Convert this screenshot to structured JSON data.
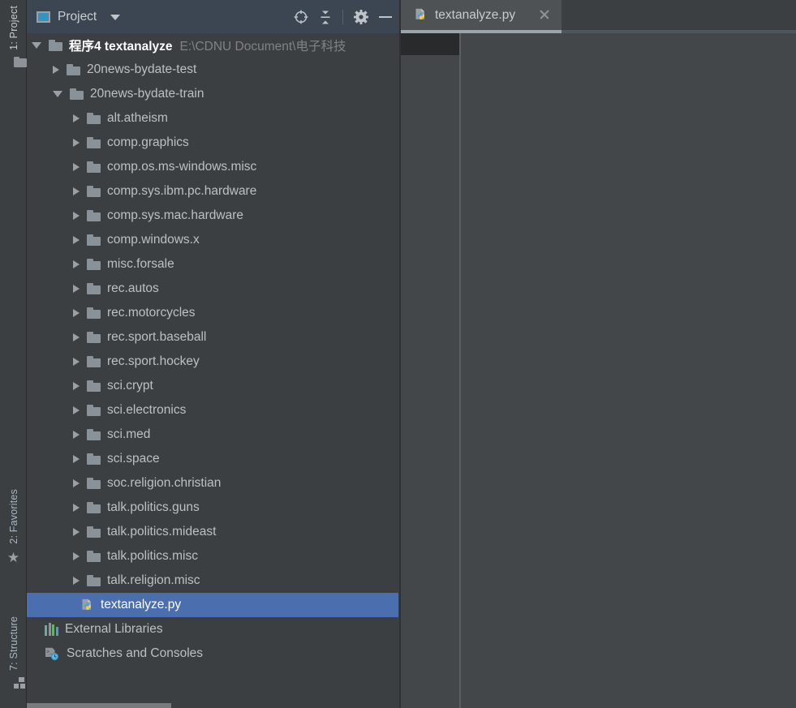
{
  "window": {
    "theme_background": "#3c3f41",
    "accent_selection": "#4b6eaf",
    "header_background": "#3c4652"
  },
  "left_tool_bar": {
    "tabs": [
      {
        "label": "1: Project",
        "icon": "folder-icon",
        "active": true
      },
      {
        "label": "2: Favorites",
        "icon": "star-icon",
        "active": false
      },
      {
        "label": "7: Structure",
        "icon": "structure-icon",
        "active": false
      }
    ]
  },
  "project_panel": {
    "title": "Project",
    "title_icon": "project-window-icon",
    "dropdown_icon": "chevron-down-icon",
    "toolbar_buttons": [
      {
        "name": "locate-in-tree",
        "icon": "crosshair-target-icon"
      },
      {
        "name": "collapse-all",
        "icon": "collapse-all-icon"
      },
      {
        "name": "settings",
        "icon": "gear-icon"
      },
      {
        "name": "hide",
        "icon": "minimize-icon"
      }
    ],
    "tree": [
      {
        "label": "程序4 textanalyze",
        "path": "E:\\CDNU Document\\电子科技",
        "type": "root",
        "state": "expanded",
        "level": 0
      },
      {
        "label": "20news-bydate-test",
        "type": "folder",
        "state": "collapsed",
        "level": 1
      },
      {
        "label": "20news-bydate-train",
        "type": "folder",
        "state": "expanded",
        "level": 1
      },
      {
        "label": "alt.atheism",
        "type": "folder",
        "state": "collapsed",
        "level": 2
      },
      {
        "label": "comp.graphics",
        "type": "folder",
        "state": "collapsed",
        "level": 2
      },
      {
        "label": "comp.os.ms-windows.misc",
        "type": "folder",
        "state": "collapsed",
        "level": 2
      },
      {
        "label": "comp.sys.ibm.pc.hardware",
        "type": "folder",
        "state": "collapsed",
        "level": 2
      },
      {
        "label": "comp.sys.mac.hardware",
        "type": "folder",
        "state": "collapsed",
        "level": 2
      },
      {
        "label": "comp.windows.x",
        "type": "folder",
        "state": "collapsed",
        "level": 2
      },
      {
        "label": "misc.forsale",
        "type": "folder",
        "state": "collapsed",
        "level": 2
      },
      {
        "label": "rec.autos",
        "type": "folder",
        "state": "collapsed",
        "level": 2
      },
      {
        "label": "rec.motorcycles",
        "type": "folder",
        "state": "collapsed",
        "level": 2
      },
      {
        "label": "rec.sport.baseball",
        "type": "folder",
        "state": "collapsed",
        "level": 2
      },
      {
        "label": "rec.sport.hockey",
        "type": "folder",
        "state": "collapsed",
        "level": 2
      },
      {
        "label": "sci.crypt",
        "type": "folder",
        "state": "collapsed",
        "level": 2
      },
      {
        "label": "sci.electronics",
        "type": "folder",
        "state": "collapsed",
        "level": 2
      },
      {
        "label": "sci.med",
        "type": "folder",
        "state": "collapsed",
        "level": 2
      },
      {
        "label": "sci.space",
        "type": "folder",
        "state": "collapsed",
        "level": 2
      },
      {
        "label": "soc.religion.christian",
        "type": "folder",
        "state": "collapsed",
        "level": 2
      },
      {
        "label": "talk.politics.guns",
        "type": "folder",
        "state": "collapsed",
        "level": 2
      },
      {
        "label": "talk.politics.mideast",
        "type": "folder",
        "state": "collapsed",
        "level": 2
      },
      {
        "label": "talk.politics.misc",
        "type": "folder",
        "state": "collapsed",
        "level": 2
      },
      {
        "label": "talk.religion.misc",
        "type": "folder",
        "state": "collapsed",
        "level": 2
      },
      {
        "label": "textanalyze.py",
        "type": "python-file",
        "state": "none",
        "level": 2,
        "selected": true
      },
      {
        "label": "External Libraries",
        "type": "libraries",
        "state": "none",
        "level": 1
      },
      {
        "label": "Scratches and Consoles",
        "type": "scratches",
        "state": "none",
        "level": 1
      }
    ]
  },
  "editor": {
    "tabs": [
      {
        "label": "textanalyze.py",
        "icon": "python-file-icon",
        "close_icon": "close-icon",
        "active": true
      }
    ]
  }
}
